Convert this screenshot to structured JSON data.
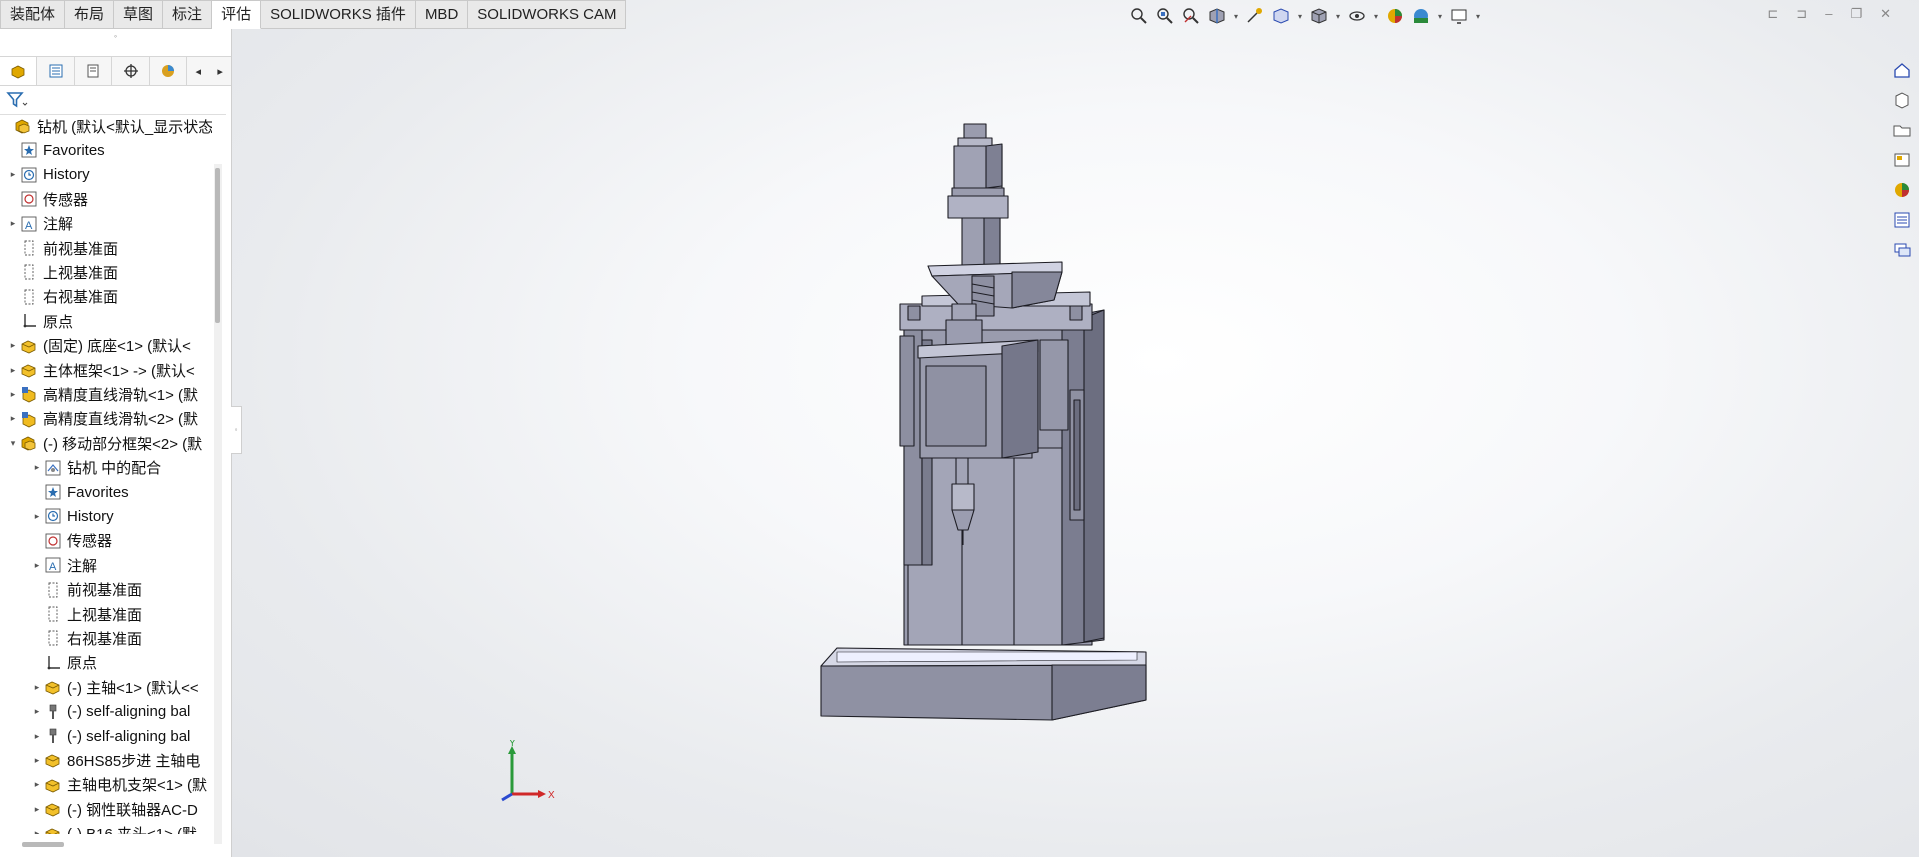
{
  "command_tabs": [
    "装配体",
    "布局",
    "草图",
    "标注",
    "评估",
    "SOLIDWORKS 插件",
    "MBD",
    "SOLIDWORKS CAM"
  ],
  "active_tab": "评估",
  "pane_tabs": [
    "featuremanager-icon",
    "propertymanager-icon",
    "configurationmanager-icon",
    "dimxpert-icon",
    "display-manager-icon"
  ],
  "tree": [
    {
      "label": "钻机 (默认<默认_显示状态",
      "indent": 0,
      "arrow": "",
      "icon": "assembly"
    },
    {
      "label": "Favorites",
      "indent": 1,
      "arrow": "",
      "icon": "favorites"
    },
    {
      "label": "History",
      "indent": 1,
      "arrow": "▸",
      "icon": "history"
    },
    {
      "label": "传感器",
      "indent": 1,
      "arrow": "",
      "icon": "sensor"
    },
    {
      "label": "注解",
      "indent": 1,
      "arrow": "▸",
      "icon": "annotation"
    },
    {
      "label": "前视基准面",
      "indent": 1,
      "arrow": "",
      "icon": "plane"
    },
    {
      "label": "上视基准面",
      "indent": 1,
      "arrow": "",
      "icon": "plane"
    },
    {
      "label": "右视基准面",
      "indent": 1,
      "arrow": "",
      "icon": "plane"
    },
    {
      "label": "原点",
      "indent": 1,
      "arrow": "",
      "icon": "origin"
    },
    {
      "label": "(固定) 底座<1> (默认<",
      "indent": 1,
      "arrow": "▸",
      "icon": "part"
    },
    {
      "label": "主体框架<1> -> (默认<",
      "indent": 1,
      "arrow": "▸",
      "icon": "part"
    },
    {
      "label": "高精度直线滑轨<1> (默",
      "indent": 1,
      "arrow": "▸",
      "icon": "subassembly"
    },
    {
      "label": "高精度直线滑轨<2> (默",
      "indent": 1,
      "arrow": "▸",
      "icon": "subassembly"
    },
    {
      "label": "(-) 移动部分框架<2> (默",
      "indent": 1,
      "arrow": "▾",
      "icon": "assembly"
    },
    {
      "label": "钻机 中的配合",
      "indent": 2,
      "arrow": "▸",
      "icon": "mates"
    },
    {
      "label": "Favorites",
      "indent": 2,
      "arrow": "",
      "icon": "favorites"
    },
    {
      "label": "History",
      "indent": 2,
      "arrow": "▸",
      "icon": "history"
    },
    {
      "label": "传感器",
      "indent": 2,
      "arrow": "",
      "icon": "sensor"
    },
    {
      "label": "注解",
      "indent": 2,
      "arrow": "▸",
      "icon": "annotation"
    },
    {
      "label": "前视基准面",
      "indent": 2,
      "arrow": "",
      "icon": "plane"
    },
    {
      "label": "上视基准面",
      "indent": 2,
      "arrow": "",
      "icon": "plane"
    },
    {
      "label": "右视基准面",
      "indent": 2,
      "arrow": "",
      "icon": "plane"
    },
    {
      "label": "原点",
      "indent": 2,
      "arrow": "",
      "icon": "origin"
    },
    {
      "label": "(-) 主轴<1> (默认<<",
      "indent": 2,
      "arrow": "▸",
      "icon": "part"
    },
    {
      "label": "(-) self-aligning bal",
      "indent": 2,
      "arrow": "▸",
      "icon": "toolbox"
    },
    {
      "label": "(-) self-aligning bal",
      "indent": 2,
      "arrow": "▸",
      "icon": "toolbox"
    },
    {
      "label": "86HS85步进 主轴电",
      "indent": 2,
      "arrow": "▸",
      "icon": "part"
    },
    {
      "label": "主轴电机支架<1> (默",
      "indent": 2,
      "arrow": "▸",
      "icon": "part"
    },
    {
      "label": "(-) 钢性联轴器AC-D",
      "indent": 2,
      "arrow": "▸",
      "icon": "part"
    },
    {
      "label": "(-) B16 夹头<1> (默",
      "indent": 2,
      "arrow": "▸",
      "icon": "part"
    }
  ],
  "headsup_icons": [
    "zoom-to-fit-icon",
    "zoom-to-area-icon",
    "previous-view-icon",
    "section-view-icon",
    "dynamic-annotation-icon",
    "view-orientation-icon",
    "display-style-icon",
    "hide-show-icon",
    "edit-appearance-icon",
    "apply-scene-icon",
    "view-settings-icon"
  ],
  "taskpane_icons": [
    "solidworks-resources-icon",
    "design-library-icon",
    "file-explorer-icon",
    "view-palette-icon",
    "appearances-icon",
    "custom-properties-icon",
    "forum-icon"
  ],
  "triad": {
    "x_label": "X",
    "y_label": "Y"
  },
  "colors": {
    "model_fill": "#9597a8",
    "model_dark": "#6f7182",
    "model_edge": "#1d1d24",
    "part_icon": "#e8b400",
    "assembly_icon": "#d99a00"
  }
}
